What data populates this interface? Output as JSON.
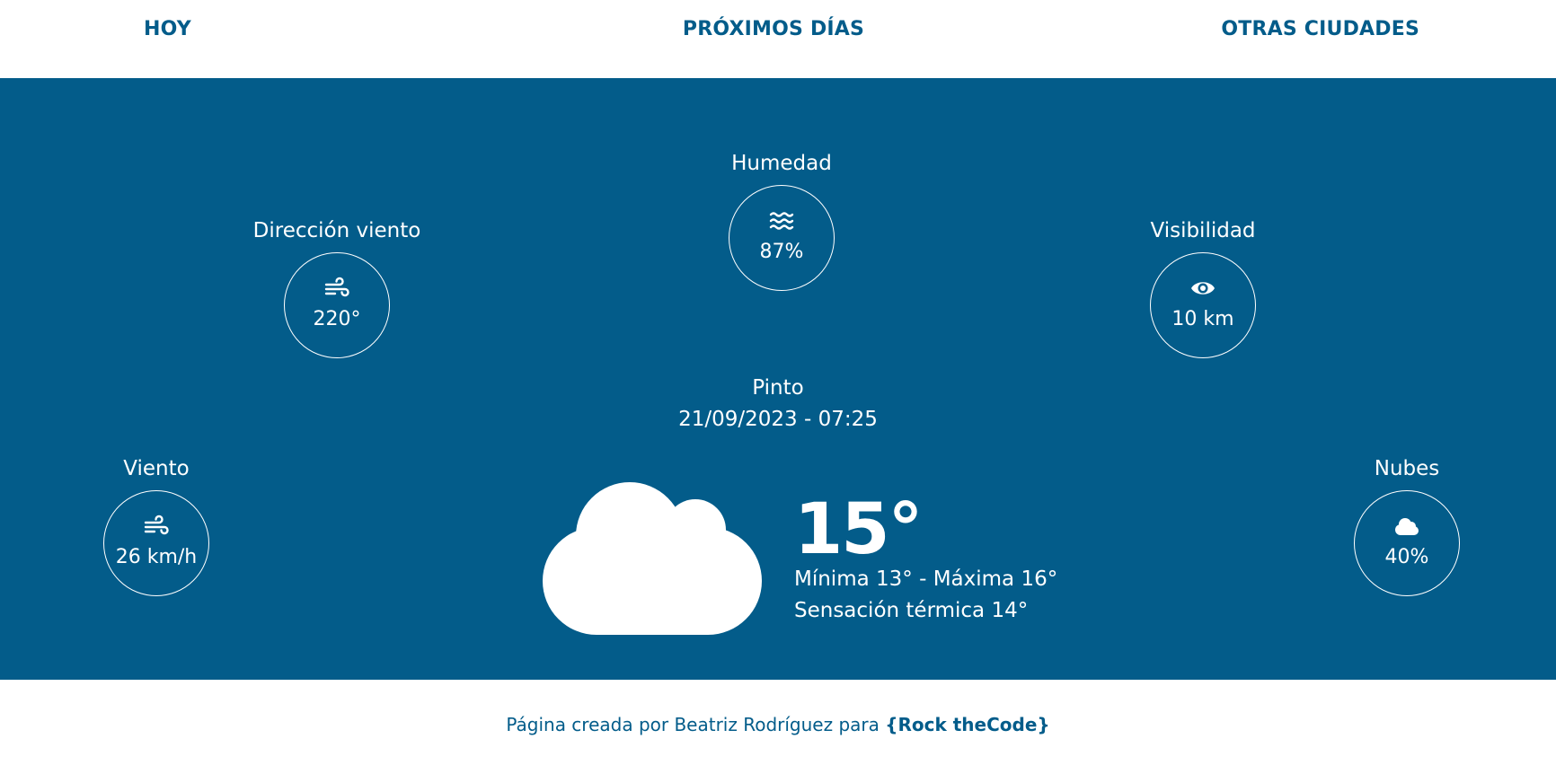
{
  "nav": {
    "today": "HOY",
    "next_days": "PRÓXIMOS DÍAS",
    "other_cities": "OTRAS CIUDADES"
  },
  "colors": {
    "primary": "#035c8a",
    "background": "#ffffff",
    "panel_text": "#ffffff"
  },
  "weather": {
    "city": "Pinto",
    "datetime": "21/09/2023 - 07:25",
    "temperature": "15°",
    "min_max": "Mínima 13° - Máxima 16°",
    "feels_like": "Sensación térmica 14°",
    "icon": "cloud-icon",
    "metrics": {
      "wind_direction": {
        "label": "Dirección viento",
        "value": "220°",
        "icon": "wind-icon"
      },
      "humidity": {
        "label": "Humedad",
        "value": "87%",
        "icon": "water-waves-icon"
      },
      "visibility": {
        "label": "Visibilidad",
        "value": "10 km",
        "icon": "eye-icon"
      },
      "wind": {
        "label": "Viento",
        "value": "26 km/h",
        "icon": "wind-icon"
      },
      "clouds": {
        "label": "Nubes",
        "value": "40%",
        "icon": "cloud-icon"
      }
    }
  },
  "footer": {
    "text": "Página creada por Beatriz Rodríguez para ",
    "brand": "{Rock theCode}"
  }
}
